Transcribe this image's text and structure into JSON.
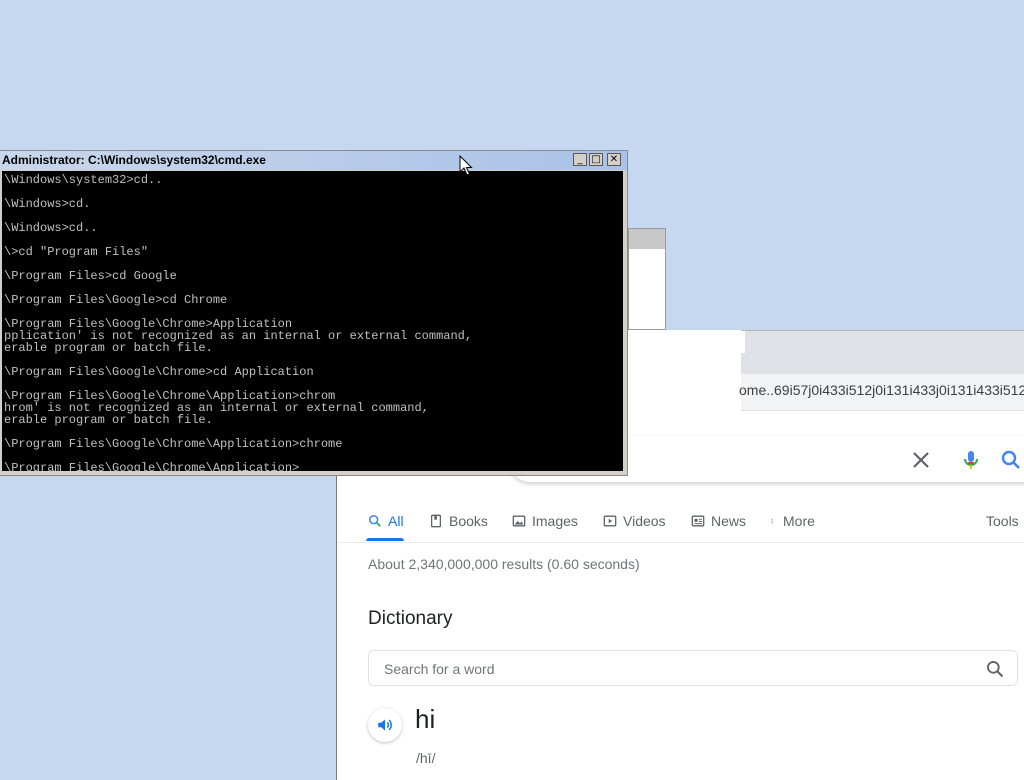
{
  "cmd": {
    "title": "Administrator: C:\\Windows\\system32\\cmd.exe",
    "minimize": "_",
    "maximize": "□",
    "close": "✕",
    "lines": [
      "\\Windows\\system32>cd..",
      "",
      "\\Windows>cd.",
      "",
      "\\Windows>cd..",
      "",
      "\\>cd \"Program Files\"",
      "",
      "\\Program Files>cd Google",
      "",
      "\\Program Files\\Google>cd Chrome",
      "",
      "\\Program Files\\Google\\Chrome>Application",
      "pplication' is not recognized as an internal or external command,",
      "erable program or batch file.",
      "",
      "\\Program Files\\Google\\Chrome>cd Application",
      "",
      "\\Program Files\\Google\\Chrome\\Application>chrom",
      "hrom' is not recognized as an internal or external command,",
      "erable program or batch file.",
      "",
      "\\Program Files\\Google\\Chrome\\Application>chrome",
      "",
      "\\Program Files\\Google\\Chrome\\Application>"
    ]
  },
  "chrome": {
    "url_visible": "ome..69i57j0i433i512j0i131i433j0i131i433i512",
    "search": {
      "clear_icon": "close-icon",
      "voice_icon": "mic-icon",
      "search_icon": "search-icon"
    },
    "tabs": [
      {
        "label": "All",
        "icon": "search-icon",
        "active": true
      },
      {
        "label": "Books",
        "icon": "book-icon",
        "active": false
      },
      {
        "label": "Images",
        "icon": "image-icon",
        "active": false
      },
      {
        "label": "Videos",
        "icon": "play-icon",
        "active": false
      },
      {
        "label": "News",
        "icon": "news-icon",
        "active": false
      },
      {
        "label": "More",
        "icon": "more-vert-icon",
        "active": false
      }
    ],
    "tools_label": "Tools",
    "result_stats": "About 2,340,000,000 results (0.60 seconds)",
    "dictionary": {
      "heading": "Dictionary",
      "search_placeholder": "Search for a word",
      "word": "hi",
      "phonetic": "/hī/"
    }
  },
  "colors": {
    "desktop": "#c5d8ef",
    "google_blue": "#1a73e8",
    "console_bg": "#000000",
    "console_fg": "#c0c0c0"
  }
}
